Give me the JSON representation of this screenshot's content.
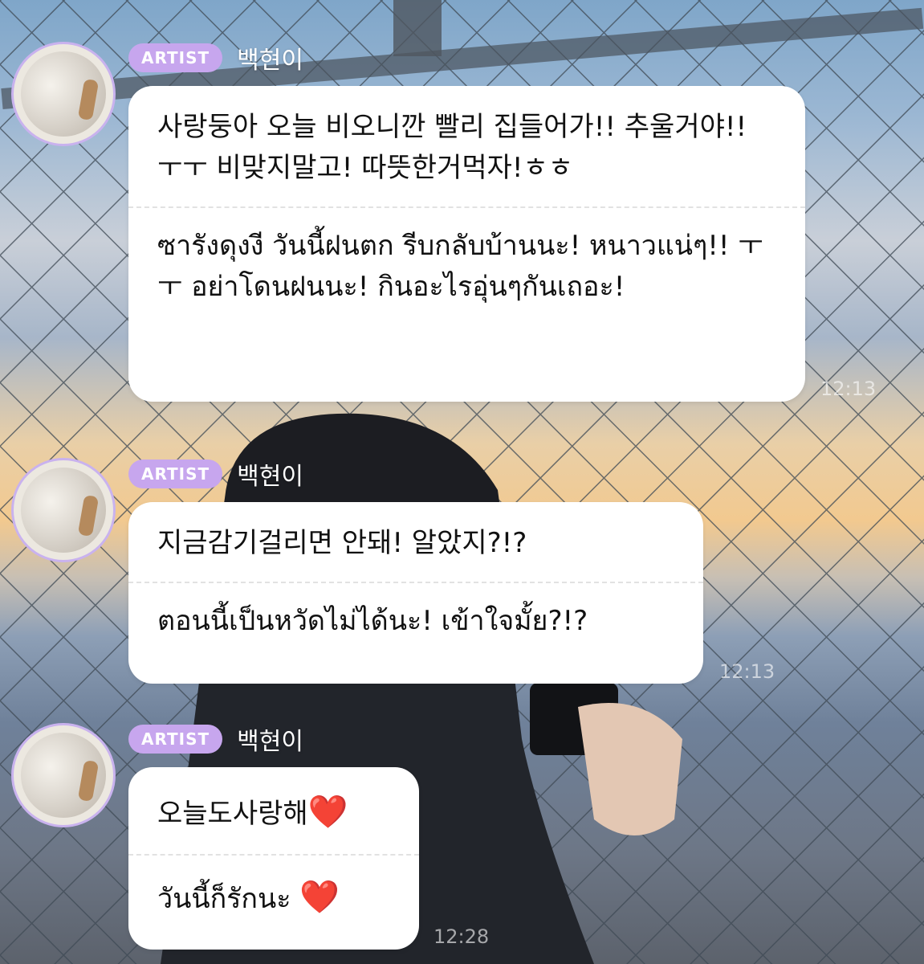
{
  "messages": [
    {
      "badge": "ARTIST",
      "author": "백현이",
      "korean": "사랑둥아 오늘 비오니깐 빨리 집들어가!! 추울거야!! ㅜㅜ 비맞지말고! 따뜻한거먹자!ㅎㅎ",
      "thai": "ซารังดุงงี วันนี้ฝนตก รีบกลับบ้านนะ! หนาวแน่ๆ!! ㅜㅜ อย่าโดนฝนนะ! กินอะไรอุ่นๆกันเถอะ!",
      "time": "12:13"
    },
    {
      "badge": "ARTIST",
      "author": "백현이",
      "korean": "지금감기걸리면 안돼! 알았지?!?",
      "thai": "ตอนนี้เป็นหวัดไม่ได้นะ! เข้าใจมั้ย?!?",
      "time": "12:13"
    },
    {
      "badge": "ARTIST",
      "author": "백현이",
      "korean": "오늘도사랑해",
      "thai": "วันนี้ก็รักนะ",
      "heart": "❤️",
      "time": "12:28"
    }
  ]
}
